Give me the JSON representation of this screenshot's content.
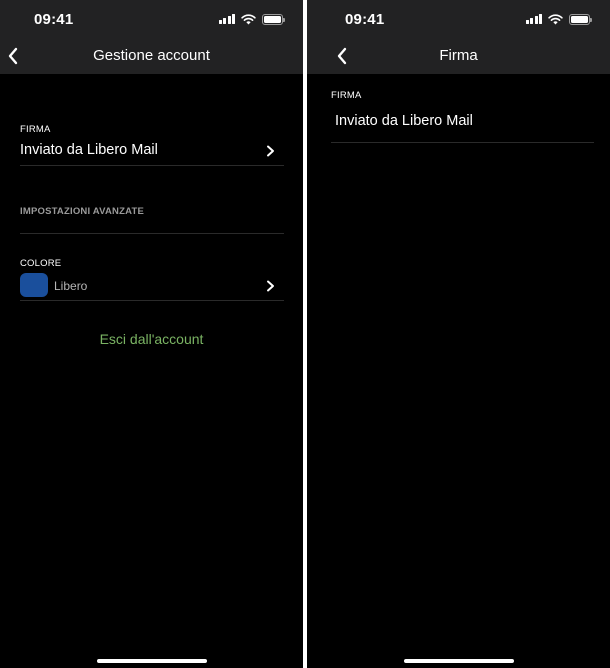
{
  "left": {
    "status": {
      "time": "09:41"
    },
    "nav": {
      "title": "Gestione account"
    },
    "firma": {
      "label": "FIRMA",
      "value": "Inviato da Libero Mail"
    },
    "advanced": {
      "label": "IMPOSTAZIONI AVANZATE"
    },
    "color": {
      "label": "COLORE",
      "name": "Libero",
      "swatch": "#1a4f9c"
    },
    "logout": "Esci dall'account"
  },
  "right": {
    "status": {
      "time": "09:41"
    },
    "nav": {
      "title": "Firma"
    },
    "firma": {
      "label": "FIRMA",
      "value": "Inviato da Libero Mail"
    }
  },
  "icons": [
    "back-chevron-icon",
    "chevron-right-icon",
    "cellular-signal-icon",
    "wifi-icon",
    "battery-icon"
  ],
  "colors": {
    "background": "#000000",
    "bar": "#222223",
    "accent_green": "#7ab363",
    "separator": "#2a2a2a"
  }
}
